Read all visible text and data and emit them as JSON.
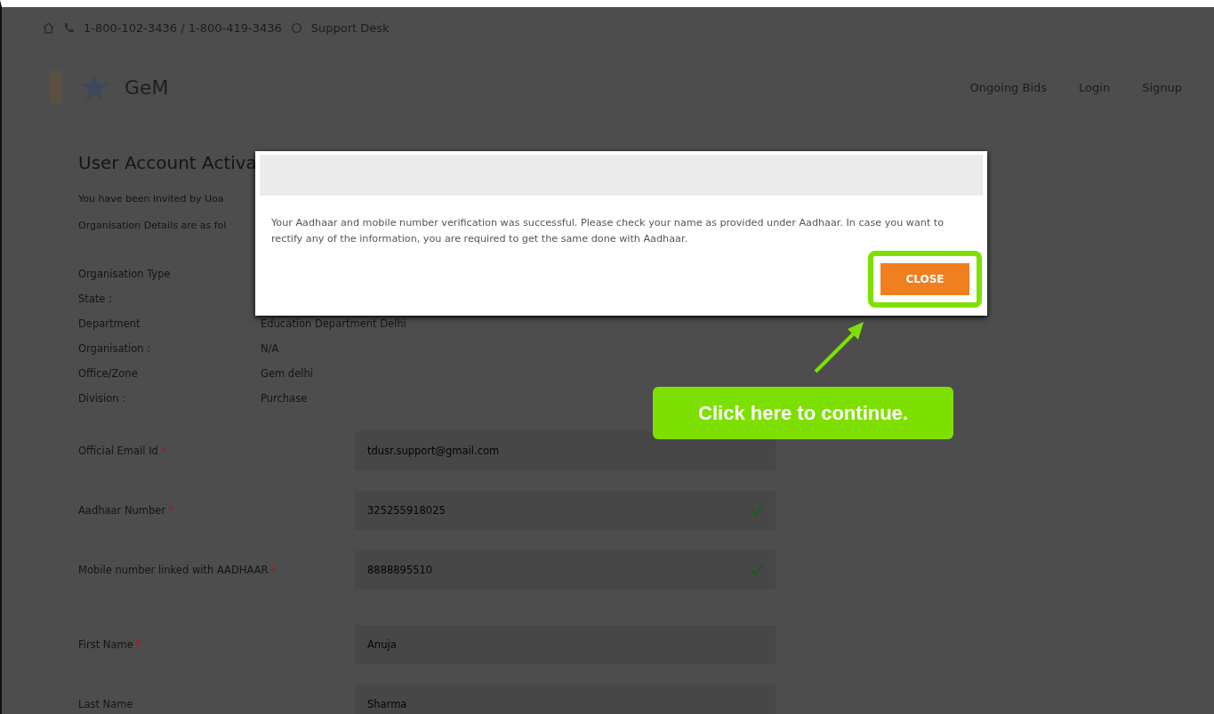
{
  "top_bar": {
    "phone": "1-800-102-3436 / 1-800-419-3436",
    "support": "Support Desk"
  },
  "header": {
    "logo_text": "GeM",
    "nav": [
      "Ongoing Bids",
      "Login",
      "Signup"
    ]
  },
  "page": {
    "title": "User Account Activa",
    "intro": [
      "You have been invited by Uoa",
      "Organisation Details are as fol"
    ],
    "details": [
      {
        "label": "Organisation Type"
      },
      {
        "label": "State :"
      },
      {
        "label": "Department",
        "value": "Education Department Delhi"
      },
      {
        "label": "Organisation :",
        "value": "N/A"
      },
      {
        "label": "Office/Zone",
        "value": "Gem delhi"
      },
      {
        "label": "Division :",
        "value": "Purchase"
      }
    ],
    "fields": [
      {
        "label": "Official Email Id",
        "required_mark": "*",
        "value": "tdusr.support@gmail.com",
        "verified": false
      },
      {
        "label": "Aadhaar Number",
        "required_mark": "*",
        "value": "325255918025",
        "verified": true
      },
      {
        "label": "Mobile number linked with AADHAAR",
        "required_mark": "*",
        "value": "8888895510",
        "verified": true
      },
      {
        "label": "First Name",
        "required_mark": "*",
        "value": "Anuja",
        "verified": false
      },
      {
        "label": "Last Name",
        "value": "Sharma",
        "verified": false
      }
    ]
  },
  "modal": {
    "message": "Your Aadhaar and mobile number verification was successful. Please check your name as provided under Aadhaar. In case you want to rectify any of the information, you are required to get the same done with Aadhaar.",
    "button": "CLOSE"
  },
  "callout": {
    "text": "Click here to continue."
  }
}
